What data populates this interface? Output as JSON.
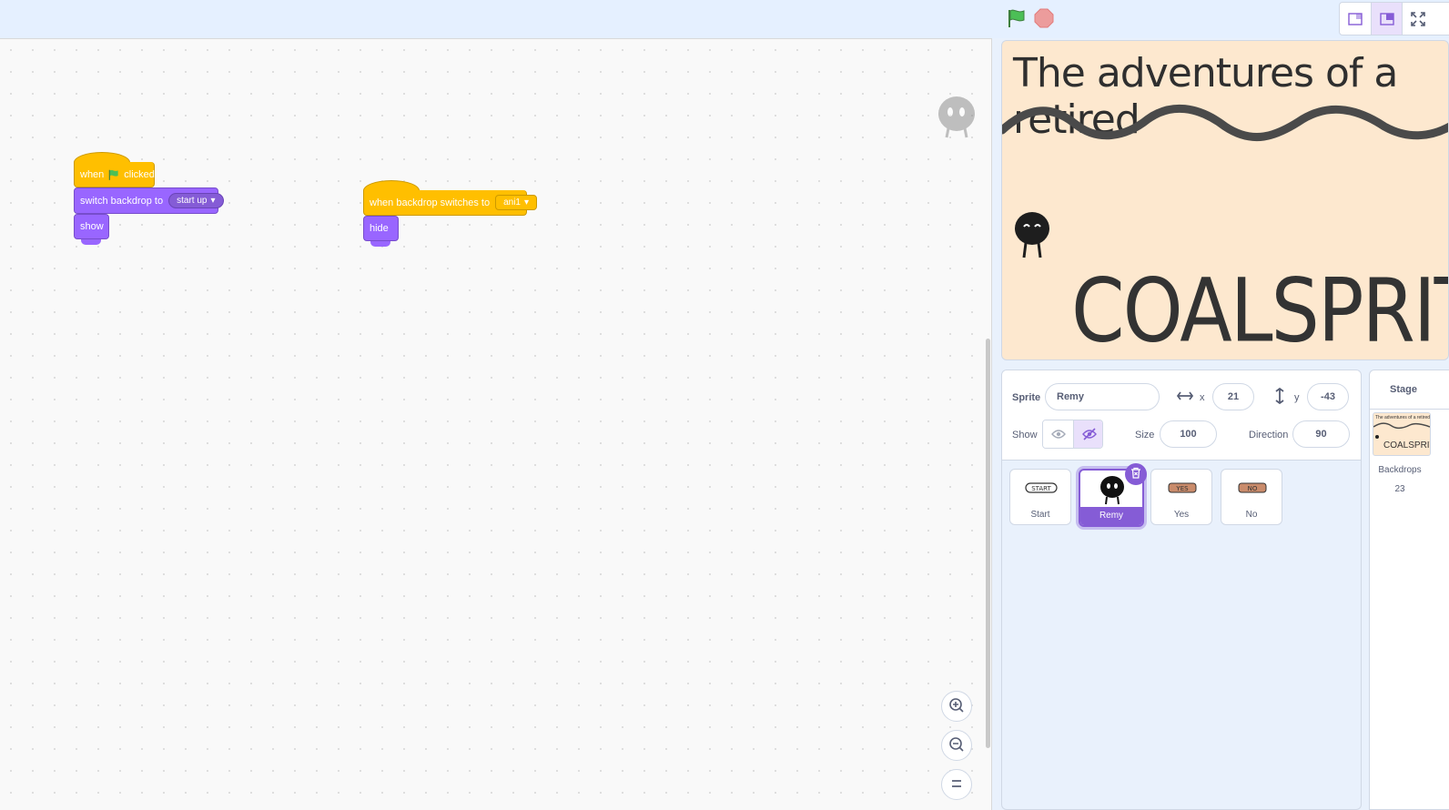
{
  "toolbar": {
    "green_flag": "green-flag-icon",
    "stop": "stop-icon",
    "layouts": [
      "small-stage-icon",
      "normal-stage-icon",
      "fullscreen-icon"
    ]
  },
  "scripts": {
    "script1": {
      "hat_when": "when",
      "hat_clicked": "clicked",
      "switch_label": "switch backdrop to",
      "switch_value": "start up",
      "show_label": "show"
    },
    "script2": {
      "hat_label": "when backdrop switches to",
      "hat_value": "ani1",
      "hide_label": "hide"
    }
  },
  "stage": {
    "title_text": "The adventures of a retired",
    "big_text": "COALSPRITE"
  },
  "sprite_info": {
    "sprite_label": "Sprite",
    "sprite_name": "Remy",
    "x_label": "x",
    "x_value": "21",
    "y_label": "y",
    "y_value": "-43",
    "show_label": "Show",
    "size_label": "Size",
    "size_value": "100",
    "direction_label": "Direction",
    "direction_value": "90"
  },
  "sprites": [
    {
      "name": "Start"
    },
    {
      "name": "Remy"
    },
    {
      "name": "Yes"
    },
    {
      "name": "No"
    }
  ],
  "stage_selector": {
    "title": "Stage",
    "backdrops_label": "Backdrops",
    "backdrops_count": "23"
  },
  "colors": {
    "events": "#ffbf00",
    "looks": "#9966ff",
    "accent": "#855cd6"
  }
}
